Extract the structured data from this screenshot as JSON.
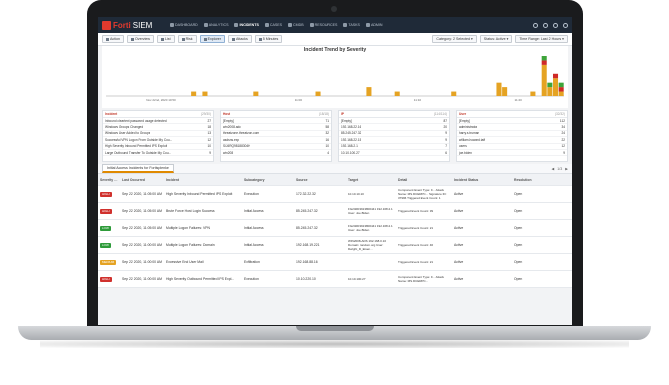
{
  "app": {
    "logo_prefix": "Forti",
    "logo_suffix": "SIEM",
    "nav": [
      "DASHBOARD",
      "ANALYTICS",
      "INCIDENTS",
      "CASES",
      "CMDB",
      "RESOURCES",
      "TASKS",
      "ADMIN"
    ],
    "active_nav": "INCIDENTS"
  },
  "toolbar": {
    "buttons": [
      "Action",
      "Overview",
      "List",
      "Risk",
      "Explorer",
      "Attacks",
      "5 Minutes"
    ],
    "active": "Explorer",
    "right": [
      "Category: 2 Selected",
      "Status: Active",
      "Time Range: Last 2 Hours"
    ]
  },
  "chart_data": {
    "type": "bar",
    "title": "Incident Trend by Severity",
    "x_labels": [
      "Nov 22nd, 2020 10:50",
      "11:00",
      "11:10",
      "11:20"
    ],
    "series": [
      {
        "color": "#e5a323",
        "values": [
          0,
          0,
          0,
          0,
          0,
          0,
          0,
          0,
          0,
          0,
          0,
          0,
          0,
          0,
          0,
          1,
          0,
          1,
          0,
          0,
          0,
          0,
          0,
          0,
          0,
          0,
          1,
          0,
          0,
          0,
          0,
          0,
          0,
          0,
          0,
          0,
          0,
          1,
          0,
          0,
          0,
          0,
          0,
          0,
          0,
          0,
          2,
          0,
          0,
          0,
          0,
          1,
          0,
          0,
          0,
          0,
          0,
          0,
          0,
          0,
          0,
          1,
          0,
          0,
          0,
          0,
          0,
          0,
          0,
          3,
          2,
          0,
          0,
          0,
          0,
          1,
          0,
          7,
          2,
          4,
          1
        ]
      },
      {
        "color": "#cf2a27",
        "values": [
          0,
          0,
          0,
          0,
          0,
          0,
          0,
          0,
          0,
          0,
          0,
          0,
          0,
          0,
          0,
          0,
          0,
          0,
          0,
          0,
          0,
          0,
          0,
          0,
          0,
          0,
          0,
          0,
          0,
          0,
          0,
          0,
          0,
          0,
          0,
          0,
          0,
          0,
          0,
          0,
          0,
          0,
          0,
          0,
          0,
          0,
          0,
          0,
          0,
          0,
          0,
          0,
          0,
          0,
          0,
          0,
          0,
          0,
          0,
          0,
          0,
          0,
          0,
          0,
          0,
          0,
          0,
          0,
          0,
          0,
          0,
          0,
          0,
          0,
          0,
          0,
          0,
          1,
          0,
          1,
          1
        ]
      },
      {
        "color": "#3ea43a",
        "values": [
          0,
          0,
          0,
          0,
          0,
          0,
          0,
          0,
          0,
          0,
          0,
          0,
          0,
          0,
          0,
          0,
          0,
          0,
          0,
          0,
          0,
          0,
          0,
          0,
          0,
          0,
          0,
          0,
          0,
          0,
          0,
          0,
          0,
          0,
          0,
          0,
          0,
          0,
          0,
          0,
          0,
          0,
          0,
          0,
          0,
          0,
          0,
          0,
          0,
          0,
          0,
          0,
          0,
          0,
          0,
          0,
          0,
          0,
          0,
          0,
          0,
          0,
          0,
          0,
          0,
          0,
          0,
          0,
          0,
          0,
          0,
          0,
          0,
          0,
          0,
          0,
          0,
          1,
          1,
          0,
          1
        ]
      }
    ]
  },
  "facets": [
    {
      "title": "Incident",
      "hint": "(29/30)",
      "rows": [
        [
          "Inbound cleartext password usage detected",
          "27"
        ],
        [
          "Windows Groups Changed",
          "18"
        ],
        [
          "Windows User Added to Groups",
          "13"
        ],
        [
          "Successful VPN Logon From Outside My Cou...",
          "12"
        ],
        [
          "High Severity Inbound Permitted IPS Exploit",
          "10"
        ],
        [
          "Large Outbound Transfer To Outside My Cou...",
          "9"
        ]
      ]
    },
    {
      "title": "Host",
      "hint": "(18/18)",
      "rows": [
        [
          "[Empty]",
          "71"
        ],
        [
          "win2008.adc",
          "58"
        ],
        [
          "threatzone.threatzon.com",
          "32"
        ],
        [
          "asdsns.exp",
          "16"
        ],
        [
          "SiJ4RQ98188304H",
          "10"
        ],
        [
          "win208",
          "4"
        ]
      ]
    },
    {
      "title": "IP",
      "hint": "(114/114)",
      "rows": [
        [
          "[Empty]",
          "87"
        ],
        [
          "192.168.22.16",
          "20"
        ],
        [
          "85.245.247.32",
          "9"
        ],
        [
          "192.168.22.15",
          "9"
        ],
        [
          "192.168.2.1",
          "7"
        ],
        [
          "10.10.100.27",
          "6"
        ]
      ]
    },
    {
      "title": "User",
      "hint": "(32/32)",
      "rows": [
        [
          "[Empty]",
          "112"
        ],
        [
          "administrator",
          "34"
        ],
        [
          "harry.s.truman",
          "24"
        ],
        [
          "william.howard.taft",
          "22"
        ],
        [
          "users",
          "12"
        ],
        [
          "joe.biden",
          "9"
        ]
      ]
    }
  ],
  "tab": {
    "label": "Initial Access Incidents for Fortisplenke",
    "pager": "1/3"
  },
  "table": {
    "headers": [
      "Severity Category",
      "Last Occurred",
      "Incident",
      "Subcategory",
      "Source",
      "Target",
      "Detail",
      "Incident Status",
      "Resolution"
    ],
    "rows": [
      [
        "HIGH",
        "Sep 22 2020, 11:05:00 AM",
        "High Severity Inbound Permitted IPS Exploit",
        "Execution",
        "172.32.22.32",
        "10.10.10.10",
        "Component Event Type: F... Attack Name: MS.DCERPC... Signature ID: 37996 Triggered Event Count: 1",
        "Active",
        "Open"
      ],
      [
        "HIGH",
        "Sep 22 2020, 11:05:00 AM",
        "Brute Force Host Login Success",
        "Initial Access",
        "85.245.247.32",
        "FG240D3913800441 192.168.2.1 User: Joe.Biden",
        "Triggered Event Count: 39",
        "Active",
        "Open"
      ],
      [
        "LOW",
        "Sep 22 2020, 11:05:00 AM",
        "Multiple Logon Failures: VPN",
        "Initial Access",
        "85.245.247.32",
        "FG240D3913800441 192.168.2.1 User: Joe.Biden",
        "Triggered Event Count: 21",
        "Active",
        "Open"
      ],
      [
        "LOW",
        "Sep 22 2020, 11:00:00 AM",
        "Multiple Logon Failures: Domain",
        "Initial Access",
        "192.168.19.221",
        "WIN2008-ADS 192.168.0.10 Domain: random.org User: Dwight_D_Eisen...",
        "Triggered Event Count: 46",
        "Active",
        "Open"
      ],
      [
        "MEDIUM",
        "Sep 22 2020, 11:00:00 AM",
        "Excessive End User Mail",
        "Exfiltration",
        "192.168.88.16",
        "",
        "Triggered Event Count: 21",
        "Active",
        "Open"
      ],
      [
        "HIGH",
        "Sep 22 2020, 11:00:00 AM",
        "High Severity Outbound Permitted IPS Expl...",
        "Execution",
        "10.10.220.10",
        "10.10.100.27",
        "Component Event Type: F... Attack Name: MS.DCERPC...",
        "Active",
        "Open"
      ]
    ],
    "sev_colors": {
      "HIGH": "#d0312d",
      "LOW": "#2e9b3a",
      "MEDIUM": "#e5a323"
    }
  }
}
